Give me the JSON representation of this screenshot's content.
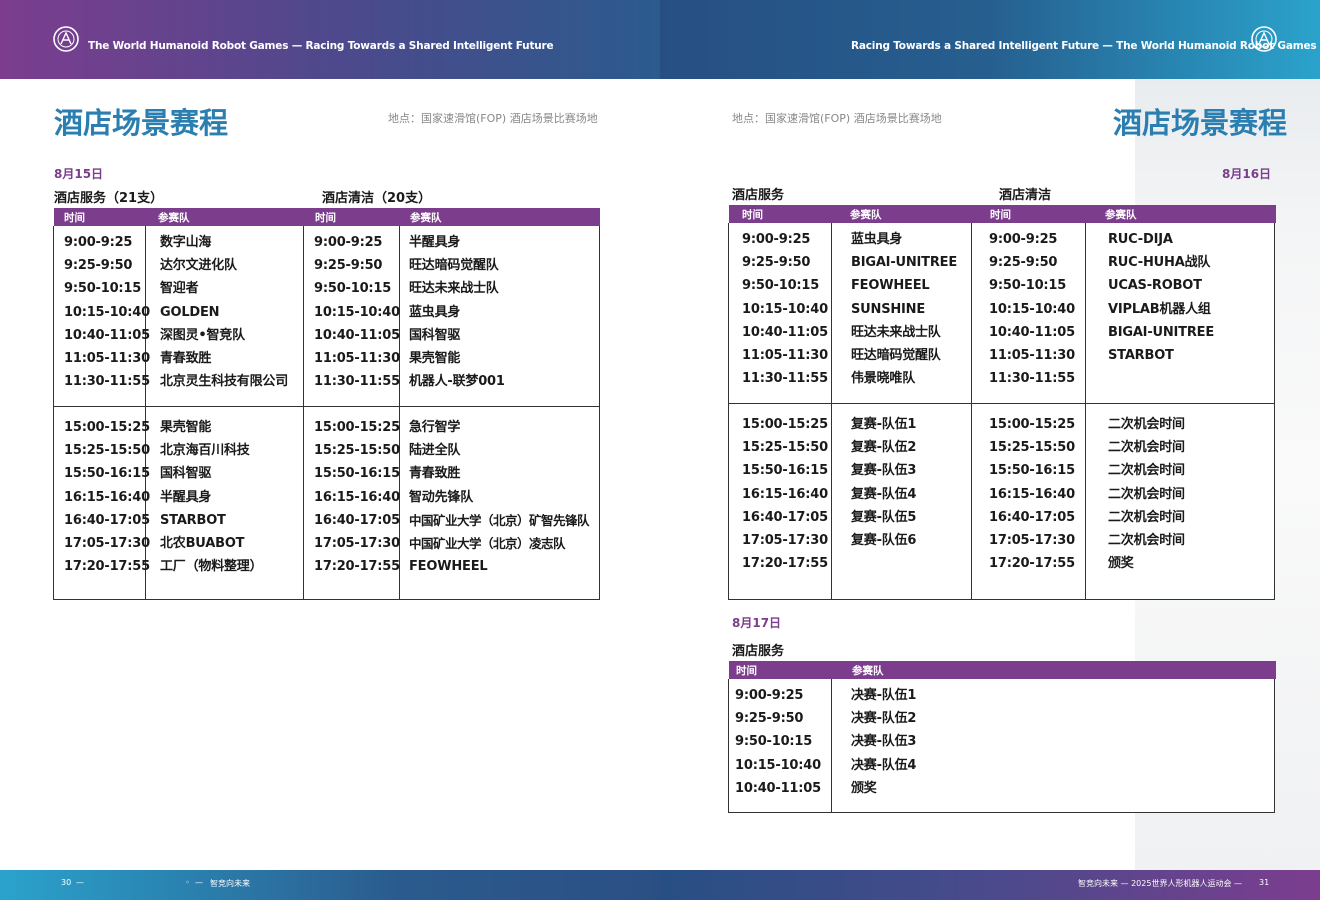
{
  "header": {
    "tagline_left": "The World Humanoid Robot Games  —  Racing Towards a Shared Intelligent Future",
    "tagline_right": "Racing Towards a Shared Intelligent Future  —  The World Humanoid Robot Games"
  },
  "left_page": {
    "title": "酒店场景赛程",
    "location": "地点：国家速滑馆(FOP) 酒店场景比赛场地",
    "date": "8月15日",
    "section_service": "酒店服务（21支）",
    "section_cleaning": "酒店清洁（20支）",
    "col_time": "时间",
    "col_team": "参赛队",
    "service_am": [
      {
        "time": "9:00-9:25",
        "team": "数字山海"
      },
      {
        "time": "9:25-9:50",
        "team": "达尔文进化队"
      },
      {
        "time": "9:50-10:15",
        "team": "智迎者"
      },
      {
        "time": "10:15-10:40",
        "team": "GOLDEN"
      },
      {
        "time": "10:40-11:05",
        "team": "深图灵•智竞队"
      },
      {
        "time": "11:05-11:30",
        "team": "青春致胜"
      },
      {
        "time": "11:30-11:55",
        "team": "北京灵生科技有限公司"
      }
    ],
    "service_pm": [
      {
        "time": "15:00-15:25",
        "team": "果壳智能"
      },
      {
        "time": "15:25-15:50",
        "team": "北京海百川科技"
      },
      {
        "time": "15:50-16:15",
        "team": "国科智驱"
      },
      {
        "time": "16:15-16:40",
        "team": "半醒具身"
      },
      {
        "time": "16:40-17:05",
        "team": "STARBOT"
      },
      {
        "time": "17:05-17:30",
        "team": "北农BUABOT"
      },
      {
        "time": "17:20-17:55",
        "team": "工厂（物料整理）"
      }
    ],
    "cleaning_am": [
      {
        "time": "9:00-9:25",
        "team": "半醒具身"
      },
      {
        "time": "9:25-9:50",
        "team": "旺达暗码觉醒队"
      },
      {
        "time": "9:50-10:15",
        "team": "旺达未来战士队"
      },
      {
        "time": "10:15-10:40",
        "team": "蓝虫具身"
      },
      {
        "time": "10:40-11:05",
        "team": "国科智驱"
      },
      {
        "time": "11:05-11:30",
        "team": "果壳智能"
      },
      {
        "time": "11:30-11:55",
        "team": "机器人-联梦001"
      }
    ],
    "cleaning_pm": [
      {
        "time": "15:00-15:25",
        "team": "急行智学"
      },
      {
        "time": "15:25-15:50",
        "team": "陆进全队"
      },
      {
        "time": "15:50-16:15",
        "team": "青春致胜"
      },
      {
        "time": "16:15-16:40",
        "team": "智动先锋队"
      },
      {
        "time": "16:40-17:05",
        "team": "中国矿业大学（北京）矿智先锋队"
      },
      {
        "time": "17:05-17:30",
        "team": "中国矿业大学（北京）凌志队"
      },
      {
        "time": "17:20-17:55",
        "team": "FEOWHEEL"
      }
    ]
  },
  "right_page": {
    "title": "酒店场景赛程",
    "location": "地点：国家速滑馆(FOP) 酒店场景比赛场地",
    "date_16": "8月16日",
    "section_service": "酒店服务",
    "section_cleaning": "酒店清洁",
    "col_time": "时间",
    "col_team": "参赛队",
    "service_am": [
      {
        "time": "9:00-9:25",
        "team": "蓝虫具身"
      },
      {
        "time": "9:25-9:50",
        "team": "BIGAI-UNITREE"
      },
      {
        "time": "9:50-10:15",
        "team": "FEOWHEEL"
      },
      {
        "time": "10:15-10:40",
        "team": "SUNSHINE"
      },
      {
        "time": "10:40-11:05",
        "team": "旺达未来战士队"
      },
      {
        "time": "11:05-11:30",
        "team": "旺达暗码觉醒队"
      },
      {
        "time": "11:30-11:55",
        "team": "伟景晓唯队"
      }
    ],
    "service_pm": [
      {
        "time": "15:00-15:25",
        "team": "复赛-队伍1"
      },
      {
        "time": "15:25-15:50",
        "team": "复赛-队伍2"
      },
      {
        "time": "15:50-16:15",
        "team": "复赛-队伍3"
      },
      {
        "time": "16:15-16:40",
        "team": "复赛-队伍4"
      },
      {
        "time": "16:40-17:05",
        "team": "复赛-队伍5"
      },
      {
        "time": "17:05-17:30",
        "team": "复赛-队伍6"
      },
      {
        "time": "17:20-17:55",
        "team": ""
      }
    ],
    "cleaning_am": [
      {
        "time": "9:00-9:25",
        "team": "RUC-DIJA"
      },
      {
        "time": "9:25-9:50",
        "team": "RUC-HUHA战队"
      },
      {
        "time": "9:50-10:15",
        "team": "UCAS-ROBOT"
      },
      {
        "time": "10:15-10:40",
        "team": "VIPLAB机器人组"
      },
      {
        "time": "10:40-11:05",
        "team": "BIGAI-UNITREE"
      },
      {
        "time": "11:05-11:30",
        "team": "STARBOT"
      },
      {
        "time": "11:30-11:55",
        "team": ""
      }
    ],
    "cleaning_pm": [
      {
        "time": "15:00-15:25",
        "team": "二次机会时间"
      },
      {
        "time": "15:25-15:50",
        "team": "二次机会时间"
      },
      {
        "time": "15:50-16:15",
        "team": "二次机会时间"
      },
      {
        "time": "16:15-16:40",
        "team": "二次机会时间"
      },
      {
        "time": "16:40-17:05",
        "team": "二次机会时间"
      },
      {
        "time": "17:05-17:30",
        "team": "二次机会时间"
      },
      {
        "time": "17:20-17:55",
        "team": "颁奖"
      }
    ],
    "date_17": "8月17日",
    "section_service_17": "酒店服务",
    "service_17": [
      {
        "time": "9:00-9:25",
        "team": "决赛-队伍1"
      },
      {
        "time": "9:25-9:50",
        "team": "决赛-队伍2"
      },
      {
        "time": "9:50-10:15",
        "team": "决赛-队伍3"
      },
      {
        "time": "10:15-10:40",
        "team": "决赛-队伍4"
      },
      {
        "time": "10:40-11:05",
        "team": "颁奖"
      }
    ]
  },
  "footer": {
    "left_page_num": "30",
    "left_slogan": "智竞向未来",
    "right_slogan": "智竞向未来  —  2025世界人形机器人运动会  —",
    "right_page_num": "31"
  }
}
